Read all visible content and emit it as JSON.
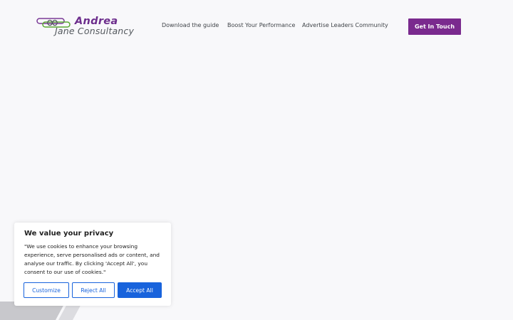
{
  "brand": {
    "line1": "Andrea",
    "line2": "Jane Consultancy",
    "primary_color": "#6c2d8c",
    "secondary_color": "#555a5f"
  },
  "nav": {
    "items": [
      {
        "label": "Download the guide"
      },
      {
        "label": "Boost Your Performance"
      },
      {
        "label": "Advertise Leaders Community"
      }
    ],
    "cta_label": "Get In Touch",
    "cta_color": "#7a2a8e"
  },
  "cookie_banner": {
    "title": "We value your privacy",
    "body": "\"We use cookies to enhance your browsing experience, serve personalised ads or content, and analyse our traffic. By clicking 'Accept All', you consent to our use of cookies.\"",
    "buttons": {
      "customize": "Customize",
      "reject": "Reject All",
      "accept": "Accept All"
    },
    "accent_color": "#1863dc"
  }
}
